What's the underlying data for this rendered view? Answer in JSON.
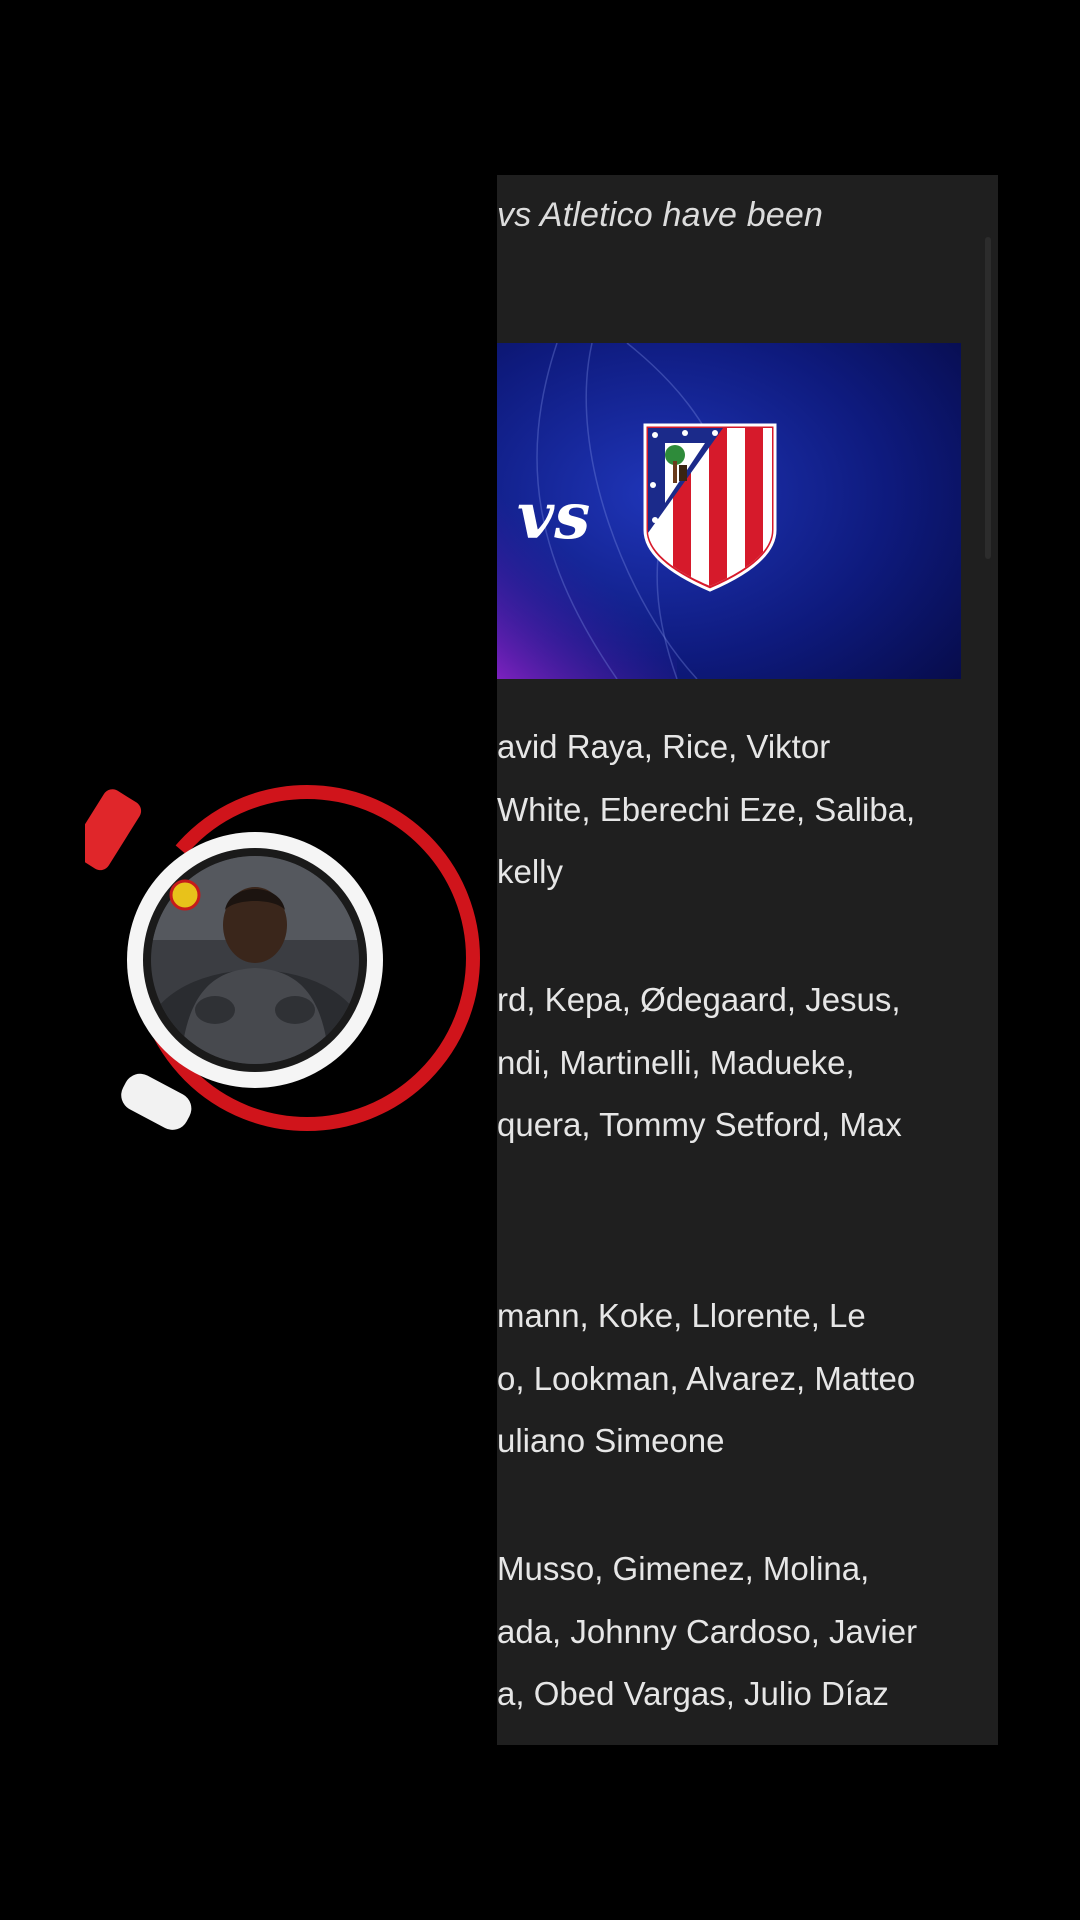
{
  "article": {
    "intro_text": "vs Atletico have been",
    "banner": {
      "vs_text": "vs",
      "crest_icon": "atletico-madrid-crest-icon"
    },
    "paragraphs": [
      [
        "avid Raya, Rice, Viktor",
        "White, Eberechi Eze, Saliba,",
        "kelly"
      ],
      [
        "rd, Kepa, Ødegaard, Jesus,",
        "ndi, Martinelli, Madueke,",
        "quera, Tommy Setford, Max"
      ],
      [
        "mann, Koke, Llorente, Le",
        "o, Lookman, Alvarez, Matteo",
        "uliano Simeone"
      ],
      [
        "Musso, Gimenez, Molina,",
        "ada, Johnny Cardoso, Javier",
        "a, Obed Vargas, Julio Díaz"
      ]
    ]
  },
  "floating_widget": {
    "avatar_icon": "person-avatar-icon",
    "badge_icon": "team-badge-icon",
    "ring_color": "#d0141b"
  },
  "colors": {
    "background": "#000000",
    "panel": "#1f1f1f",
    "text": "#e6e6e6",
    "banner_navy": "#0a0f5c",
    "accent_red": "#d0141b"
  }
}
